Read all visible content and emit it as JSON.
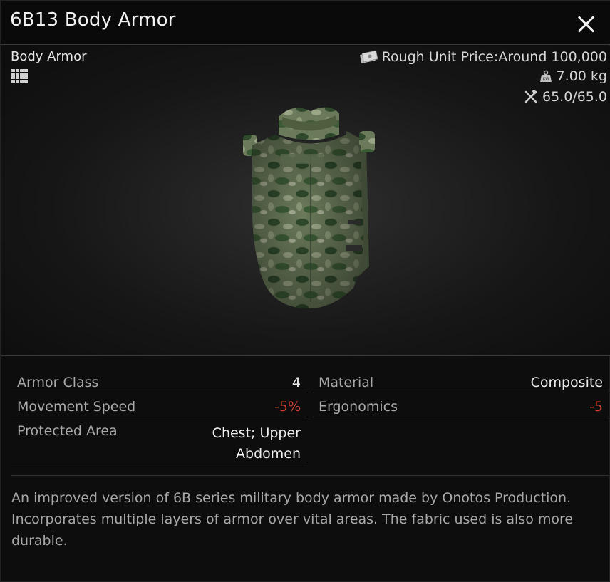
{
  "window": {
    "title": "6B13 Body Armor"
  },
  "viewer": {
    "category": "Body Armor",
    "price_label": "Rough Unit Price:Around 100,000",
    "weight": "7.00 kg",
    "durability": "65.0/65.0"
  },
  "properties": [
    {
      "label": "Armor Class",
      "value": "4",
      "negative": false
    },
    {
      "label": "Material",
      "value": "Composite",
      "negative": false
    },
    {
      "label": "Movement Speed",
      "value": "-5%",
      "negative": true
    },
    {
      "label": "Ergonomics",
      "value": "-5",
      "negative": true
    },
    {
      "label": "Protected Area",
      "value_line1": "Chest; Upper",
      "value_line2": "Abdomen",
      "negative": false
    }
  ],
  "description": "An improved version of 6B series military body armor made by Onotos Production. Incorporates multiple layers of armor over vital areas. The fabric used is also more durable.",
  "colors": {
    "negative": "#d23b35",
    "label": "#a9a9a9",
    "value": "#eeeeee",
    "background": "#0d0d0d"
  },
  "icons": {
    "close": "close-icon",
    "grid": "grid-size-icon",
    "price": "banknote-icon",
    "weight": "weight-icon",
    "durability": "wrench-icon"
  }
}
